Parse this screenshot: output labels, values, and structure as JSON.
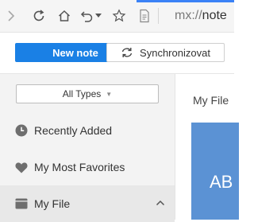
{
  "browser": {
    "url_scheme": "mx://",
    "url_host": "note",
    "progress_color": "#3b82f6",
    "icons": [
      "forward-icon",
      "reload-icon",
      "home-icon",
      "undo-icon",
      "dropdown-caret-icon",
      "star-icon",
      "page-icon"
    ]
  },
  "actions": {
    "new_note_label": "New note",
    "sync_label": "Synchronizovat",
    "accent": "#1a80e5"
  },
  "sidebar": {
    "filter_label": "All Types",
    "items": [
      {
        "label": "Recently Added",
        "icon": "clock-icon"
      },
      {
        "label": "My Most Favorites",
        "icon": "heart-icon"
      },
      {
        "label": "My File",
        "icon": "folder-icon",
        "expanded": true
      }
    ]
  },
  "main": {
    "breadcrumb": "My File",
    "card_text": "AB",
    "card_color": "#5b92d4"
  }
}
